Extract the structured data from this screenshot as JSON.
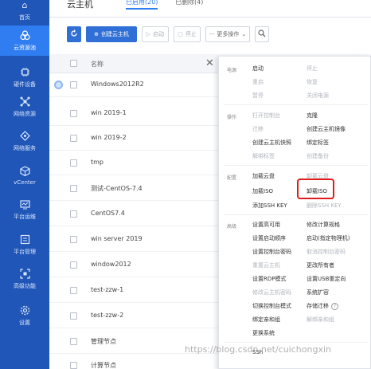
{
  "sidebar": {
    "items": [
      {
        "label": "首页",
        "icon": "home-icon"
      },
      {
        "label": "云资源池",
        "icon": "cloud-pool-icon"
      },
      {
        "label": "硬件设备",
        "icon": "hardware-icon"
      },
      {
        "label": "网络资源",
        "icon": "network-icon"
      },
      {
        "label": "网络服务",
        "icon": "network-service-icon"
      },
      {
        "label": "vCenter",
        "icon": "vcenter-icon"
      },
      {
        "label": "平台运维",
        "icon": "ops-icon"
      },
      {
        "label": "平台管理",
        "icon": "platform-icon"
      },
      {
        "label": "高级功能",
        "icon": "advanced-icon"
      },
      {
        "label": "设置",
        "icon": "settings-icon"
      }
    ],
    "active_index": 1
  },
  "header": {
    "title": "云主机",
    "tabs": [
      {
        "label": "已启用(20)"
      },
      {
        "label": "已删除(4)"
      }
    ]
  },
  "toolbar": {
    "refresh_icon": "refresh-icon",
    "create_label": "创建云主机",
    "start_label": "启动",
    "stop_label": "停止",
    "more_label": "更多操作",
    "search_icon": "search-icon"
  },
  "table": {
    "header_name": "名称",
    "rows": [
      {
        "name": "Windows2012R2"
      },
      {
        "name": "win 2019-1"
      },
      {
        "name": "win 2019-2"
      },
      {
        "name": "tmp"
      },
      {
        "name": "测试-CentOS-7.4"
      },
      {
        "name": "CentOS7.4"
      },
      {
        "name": "win server 2019"
      },
      {
        "name": "window2012"
      },
      {
        "name": "test-zzw-1"
      },
      {
        "name": "test-zzw-2"
      },
      {
        "name": "管理节点"
      },
      {
        "name": "计算节点"
      }
    ]
  },
  "menu": {
    "groups": [
      {
        "label": "电源"
      },
      {
        "label": "操作"
      },
      {
        "label": "配置"
      },
      {
        "label": "高级"
      }
    ],
    "items": {
      "start": "启动",
      "stop": "停止",
      "reboot": "重启",
      "resume": "恢复",
      "pause": "暂停",
      "power_off": "关闭电源",
      "open_console": "打开控制台",
      "clone": "克隆",
      "migrate": "迁移",
      "create_image": "创建云主机镜像",
      "create_snapshot": "创建云主机快照",
      "bind_tag": "绑定标签",
      "unbind_tag": "解绑标签",
      "create_backup": "创建备份",
      "attach_volume": "加载云盘",
      "detach_volume": "卸载云盘",
      "attach_iso": "加载ISO",
      "detach_iso": "卸载ISO",
      "add_ssh_key": "添加SSH KEY",
      "remove_ssh_key": "删除SSH KEY",
      "set_ha": "设置高可用",
      "change_spec": "修改计算规格",
      "set_boot_order": "设置启动顺序",
      "boot_pm": "启动(指定物理机)",
      "set_console_pwd": "设置控制台密码",
      "cancel_console_pwd": "取消控制台密码",
      "reset_vm": "重置云主机",
      "change_owner": "更改所有者",
      "set_rdp": "设置RDP模式",
      "set_usb": "设置USB重定向",
      "modify_vm_pwd": "修改云主机密码",
      "system_expand": "系统扩容",
      "switch_console_mode": "切换控制台模式",
      "storage_migrate": "存储迁移",
      "bind_affinity": "绑定亲和组",
      "unbind_affinity": "解绑亲和组",
      "change_system": "更换系统",
      "ssh": "SSh"
    },
    "highlighted_item": "卸载ISO"
  },
  "watermark": "https://blog.csdn.net/cuichongxin",
  "colors": {
    "sidebar": "#1f56b8",
    "sidebar_active": "#2f7df0",
    "primary": "#2f6fd6",
    "highlight_box": "#e11b1b"
  }
}
